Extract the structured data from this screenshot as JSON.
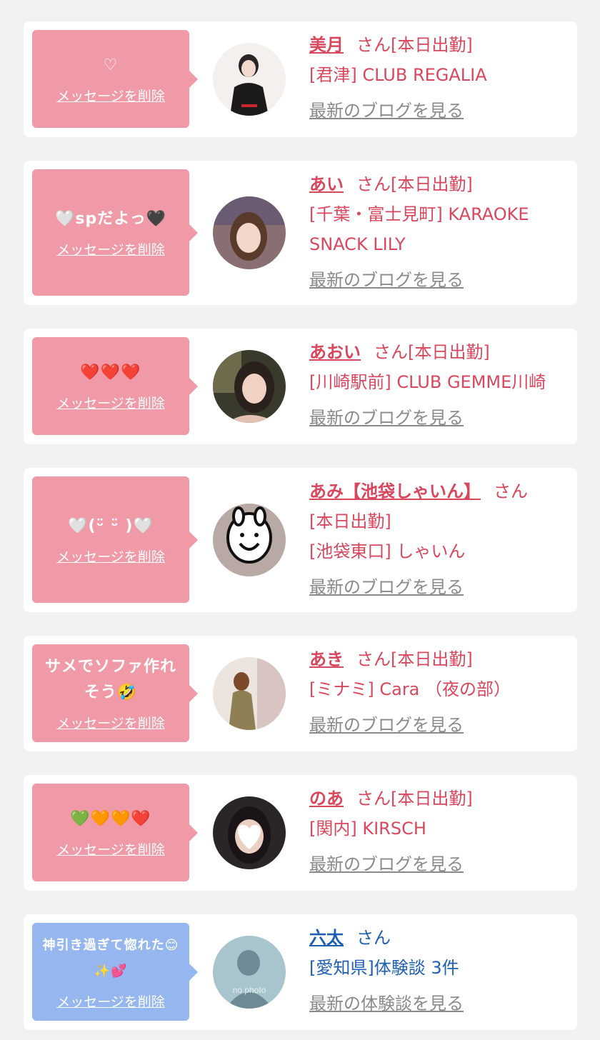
{
  "colors": {
    "pink": "#ef9aa6",
    "blue": "#95b6ee",
    "accent": "#d9475d",
    "link_blue": "#1f5fb3"
  },
  "delete_label": "メッセージを削除",
  "items": [
    {
      "message": "♡",
      "name": "美月",
      "honorific": "さん[本日出勤]",
      "shop": "[君津] CLUB REGALIA",
      "link": "最新のブログを見る"
    },
    {
      "message": "🤍spだよっ🖤",
      "name": "あい",
      "honorific": "さん[本日出勤]",
      "shop": "[千葉・富士見町] KARAOKE SNACK LILY",
      "link": "最新のブログを見る"
    },
    {
      "message": "❤️❤️❤️",
      "name": "あおい",
      "honorific": "さん[本日出勤]",
      "shop": "[川崎駅前] CLUB GEMME川崎",
      "link": "最新のブログを見る"
    },
    {
      "message": "🤍(ᵕ̈ ᵕ̈ )🤍",
      "name": "あみ【池袋しゃいん】",
      "honorific": "さん",
      "status": "[本日出勤]",
      "shop": "[池袋東口] しゃいん",
      "link": "最新のブログを見る"
    },
    {
      "message": "サメでソファ作れそう🤣",
      "name": "あき",
      "honorific": "さん[本日出勤]",
      "shop": "[ミナミ] Cara （夜の部）",
      "link": "最新のブログを見る"
    },
    {
      "message": "💚🧡🧡❤️",
      "name": "のあ",
      "honorific": "さん[本日出勤]",
      "shop": "[関内] KIRSCH",
      "link": "最新のブログを見る"
    },
    {
      "message": "神引き過ぎて惚れた😊✨💕",
      "name": "六太",
      "honorific": "さん",
      "shop": "[愛知県]体験談 3件",
      "link": "最新の体験談を見る",
      "avatar_text": "no photo"
    }
  ]
}
